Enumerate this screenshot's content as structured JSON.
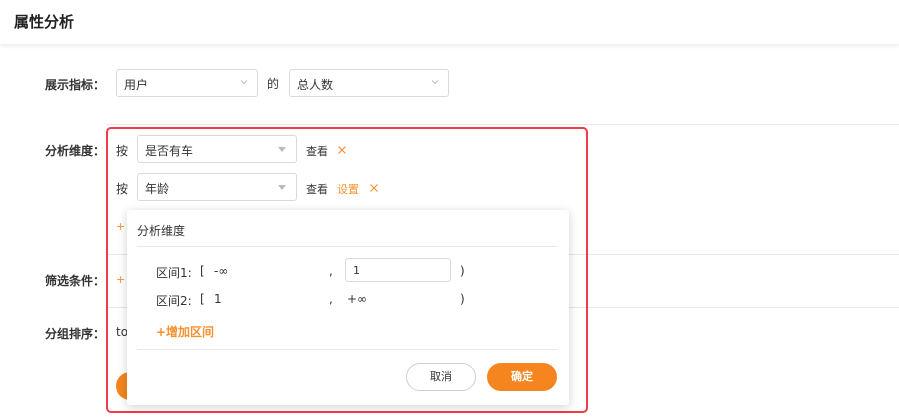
{
  "page": {
    "title": "属性分析"
  },
  "display_metric": {
    "label": "展示指标：",
    "entity": "用户",
    "connector": "的",
    "metric": "总人数"
  },
  "dimension": {
    "label": "分析维度：",
    "rows": [
      {
        "prefix": "按",
        "value": "是否有车",
        "view": "查看",
        "settings": ""
      },
      {
        "prefix": "按",
        "value": "年龄",
        "view": "查看",
        "settings": "设置"
      }
    ],
    "add_partial": "+",
    "close_glyph": "✕"
  },
  "filter": {
    "label": "筛选条件：",
    "add_partial": "+"
  },
  "group_sort": {
    "label": "分组排序：",
    "value_partial": "to"
  },
  "popover": {
    "title": "分析维度",
    "intervals": [
      {
        "label": "区间1:",
        "open": "[",
        "from": "-∞",
        "comma": ",",
        "to": "1",
        "close": ")"
      },
      {
        "label": "区间2:",
        "open": "[",
        "from": "1",
        "comma": ",",
        "to": "+∞",
        "close": ")"
      }
    ],
    "add_interval": "+增加区间",
    "cancel": "取消",
    "confirm": "确定"
  },
  "colors": {
    "accent": "#f5861f",
    "highlight_frame": "#f03b4a"
  }
}
